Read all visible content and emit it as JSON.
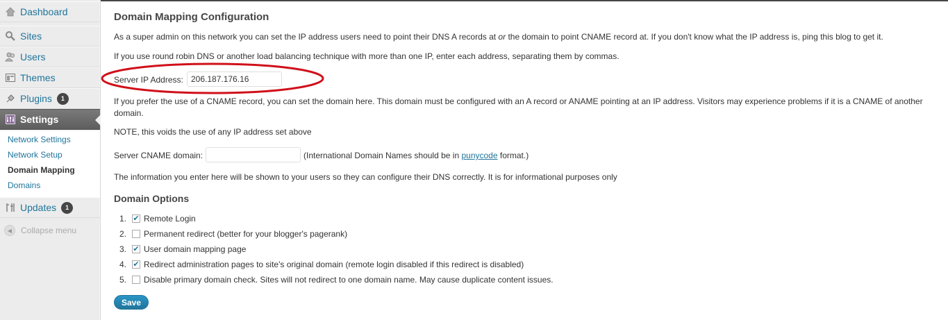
{
  "sidebar": {
    "items": [
      {
        "label": "Dashboard",
        "icon": "dashboard-icon"
      },
      {
        "label": "Sites",
        "icon": "sites-icon"
      },
      {
        "label": "Users",
        "icon": "users-icon"
      },
      {
        "label": "Themes",
        "icon": "themes-icon"
      },
      {
        "label": "Plugins",
        "icon": "plugins-icon",
        "badge": "1"
      },
      {
        "label": "Settings",
        "icon": "settings-icon"
      },
      {
        "label": "Updates",
        "icon": "updates-icon",
        "badge": "1"
      }
    ],
    "submenu": [
      "Network Settings",
      "Network Setup",
      "Domain Mapping",
      "Domains"
    ],
    "collapse_label": "Collapse menu"
  },
  "main": {
    "title": "Domain Mapping Configuration",
    "intro_1": "As a super admin on this network you can set the IP address users need to point their DNS A records at",
    "intro_or": "or",
    "intro_2": "the domain to point CNAME record at. If you don't know what the IP address is, ping this blog to get it.",
    "intro_line2": "If you use round robin DNS or another load balancing technique with more than one IP, enter each address, separating them by commas.",
    "ip_label": "Server IP Address:",
    "ip_value": "206.187.176.16",
    "cname_text": "If you prefer the use of a CNAME record, you can set the domain here. This domain must be configured with an A record or ANAME pointing at an IP address. Visitors may experience problems if it is a CNAME of another domain.",
    "note": "NOTE, this voids the use of any IP address set above",
    "cname_label": "Server CNAME domain:",
    "cname_value": "",
    "cname_hint_1": "(International Domain Names should be in",
    "cname_hint_link": "punycode",
    "cname_hint_2": "format.)",
    "info_text": "The information you enter here will be shown to your users so they can configure their DNS correctly. It is for informational purposes only",
    "options_title": "Domain Options",
    "options": [
      {
        "num": "1.",
        "label": "Remote Login",
        "checked": true
      },
      {
        "num": "2.",
        "label": "Permanent redirect (better for your blogger's pagerank)",
        "checked": false
      },
      {
        "num": "3.",
        "label": "User domain mapping page",
        "checked": true
      },
      {
        "num": "4.",
        "label": "Redirect administration pages to site's original domain (remote login disabled if this redirect is disabled)",
        "checked": true
      },
      {
        "num": "5.",
        "label": "Disable primary domain check. Sites will not redirect to one domain name. May cause duplicate content issues.",
        "checked": false
      }
    ],
    "save_label": "Save"
  },
  "colors": {
    "accent": "#21759b",
    "annotation": "#d0101a"
  }
}
